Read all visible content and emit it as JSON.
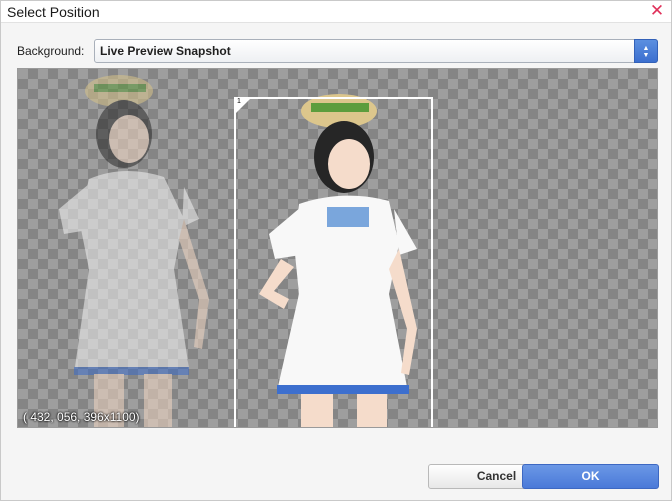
{
  "window": {
    "title": "Select Position",
    "close_icon": "close-icon"
  },
  "background": {
    "label": "Background:",
    "selected": "Live Preview Snapshot",
    "dropdown_icon": "up-down-chevron-icon"
  },
  "canvas": {
    "selection_number": "1",
    "coords": "( 432,  056, 396x1100)"
  },
  "buttons": {
    "cancel": "Cancel",
    "ok": "OK"
  },
  "colors": {
    "accent": "#4a79d8",
    "close": "#e0305a",
    "selection": "#ffffff"
  }
}
